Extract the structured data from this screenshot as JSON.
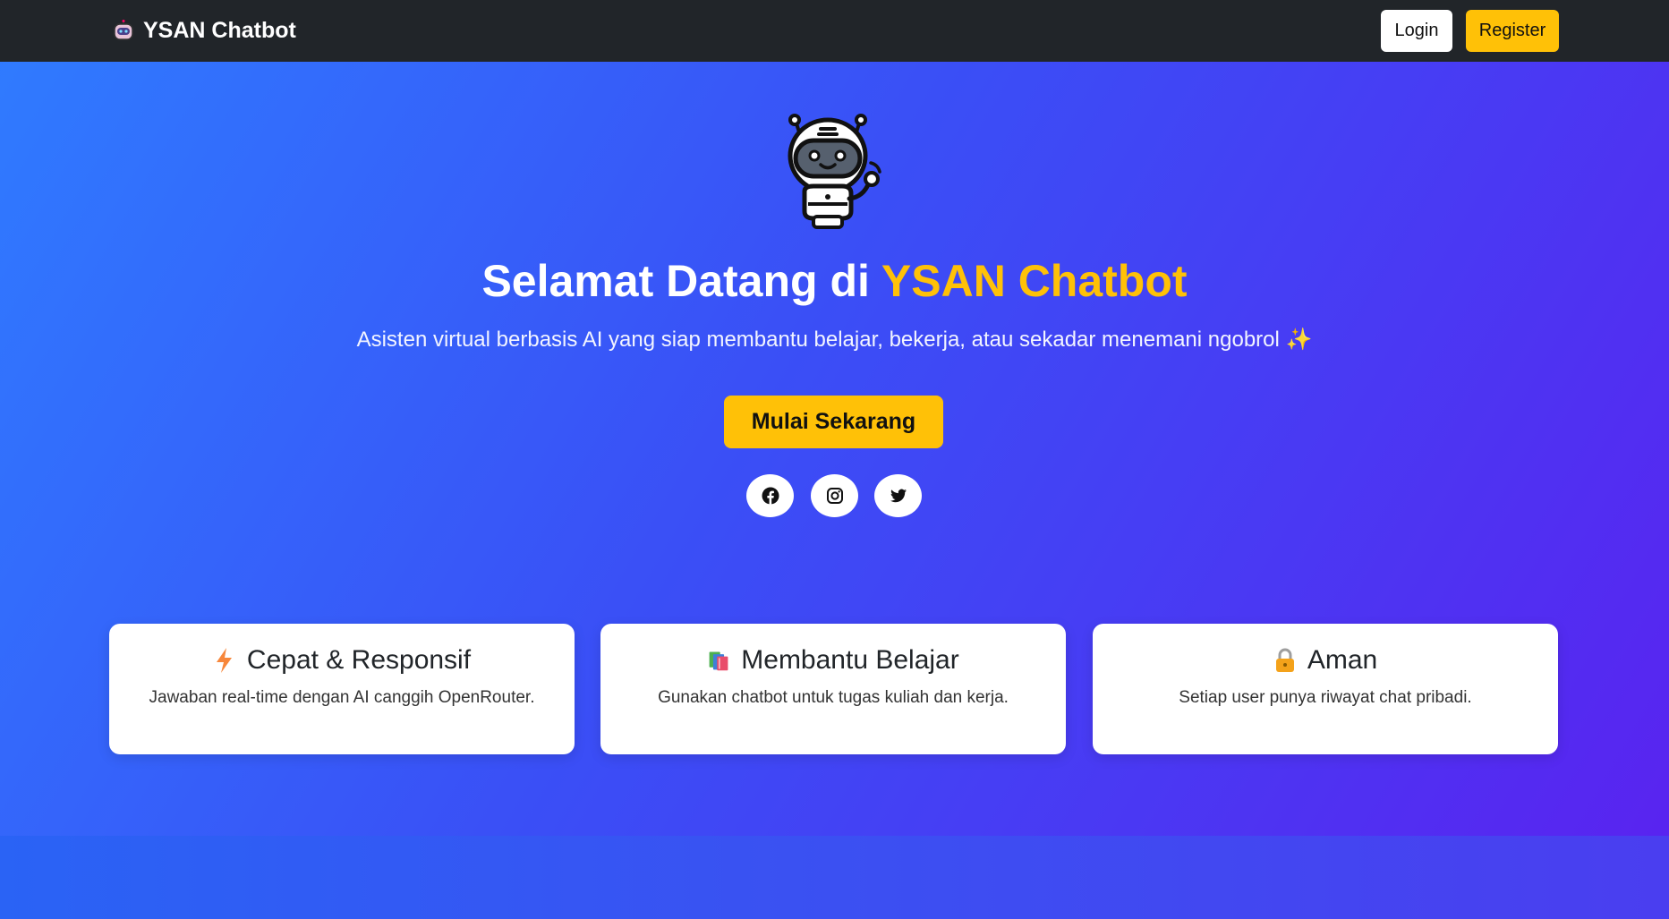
{
  "navbar": {
    "brand": "YSAN Chatbot",
    "brand_icon": "robot-icon",
    "login_label": "Login",
    "register_label": "Register"
  },
  "hero": {
    "title_prefix": "Selamat Datang di ",
    "title_accent": "YSAN Chatbot",
    "subtitle": "Asisten virtual berbasis AI yang siap membantu belajar, bekerja, atau sekadar menemani ngobrol",
    "subtitle_emoji": "✨",
    "cta_label": "Mulai Sekarang",
    "mascot_icon": "robot-mascot-icon",
    "social": [
      {
        "name": "facebook-icon"
      },
      {
        "name": "instagram-icon"
      },
      {
        "name": "twitter-icon"
      }
    ]
  },
  "features": [
    {
      "icon": "lightning-icon",
      "title": "Cepat & Responsif",
      "desc": "Jawaban real-time dengan AI canggih OpenRouter."
    },
    {
      "icon": "books-icon",
      "title": "Membantu Belajar",
      "desc": "Gunakan chatbot untuk tugas kuliah dan kerja."
    },
    {
      "icon": "lock-icon",
      "title": "Aman",
      "desc": "Setiap user punya riwayat chat pribadi."
    }
  ],
  "colors": {
    "navbar_bg": "#212529",
    "accent": "#ffc107",
    "hero_gradient_start": "#2f7cff",
    "hero_gradient_end": "#5a22f0"
  }
}
